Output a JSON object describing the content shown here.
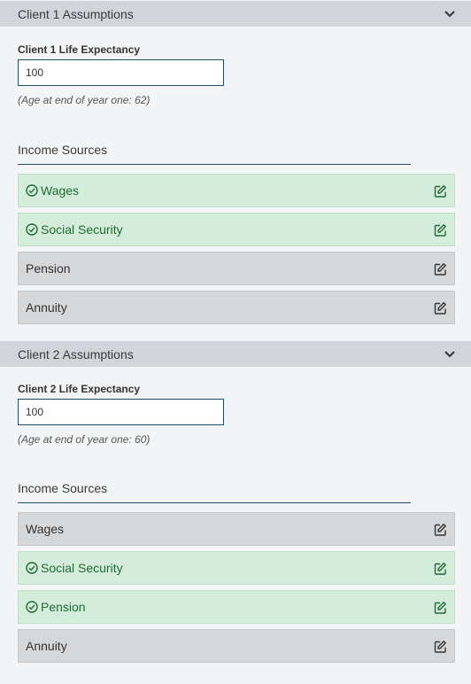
{
  "client1": {
    "header": "Client 1 Assumptions",
    "life_label": "Client 1 Life Expectancy",
    "life_value": "100",
    "age_hint": "(Age at end of year one: 62)",
    "income_title": "Income Sources",
    "sources": [
      {
        "label": "Wages",
        "active": true
      },
      {
        "label": "Social Security",
        "active": true
      },
      {
        "label": "Pension",
        "active": false
      },
      {
        "label": "Annuity",
        "active": false
      }
    ]
  },
  "client2": {
    "header": "Client 2 Assumptions",
    "life_label": "Client 2 Life Expectancy",
    "life_value": "100",
    "age_hint": "(Age at end of year one: 60)",
    "income_title": "Income Sources",
    "sources": [
      {
        "label": "Wages",
        "active": false
      },
      {
        "label": "Social Security",
        "active": true
      },
      {
        "label": "Pension",
        "active": true
      },
      {
        "label": "Annuity",
        "active": false
      }
    ]
  },
  "colors": {
    "header_bg": "#d1d5d9",
    "active_bg": "#d4ecda",
    "active_text": "#1e6b33",
    "inactive_bg": "#d6d7d9",
    "accent": "#1f4e6b"
  },
  "icons": {
    "collapse": "chevron-down-icon",
    "active": "check-circle-icon",
    "edit": "edit-icon"
  }
}
